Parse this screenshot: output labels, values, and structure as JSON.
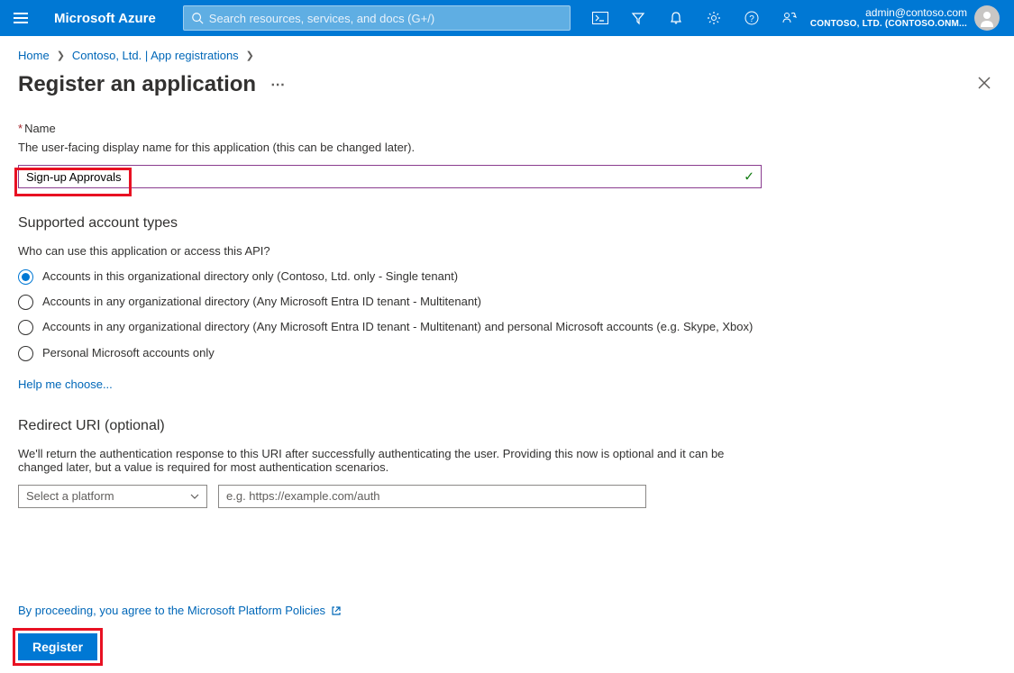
{
  "header": {
    "brand": "Microsoft Azure",
    "search_placeholder": "Search resources, services, and docs (G+/)",
    "user_email": "admin@contoso.com",
    "user_tenant": "CONTOSO, LTD. (CONTOSO.ONM..."
  },
  "breadcrumb": {
    "items": [
      "Home",
      "Contoso, Ltd. | App registrations"
    ]
  },
  "page": {
    "title": "Register an application"
  },
  "form": {
    "name_label": "Name",
    "name_desc": "The user-facing display name for this application (this can be changed later).",
    "name_value": "Sign-up Approvals",
    "account_types_title": "Supported account types",
    "account_types_question": "Who can use this application or access this API?",
    "account_options": [
      {
        "label": "Accounts in this organizational directory only (Contoso, Ltd. only - Single tenant)",
        "selected": true
      },
      {
        "label": "Accounts in any organizational directory (Any Microsoft Entra ID tenant - Multitenant)",
        "selected": false
      },
      {
        "label": "Accounts in any organizational directory (Any Microsoft Entra ID tenant - Multitenant) and personal Microsoft accounts (e.g. Skype, Xbox)",
        "selected": false
      },
      {
        "label": "Personal Microsoft accounts only",
        "selected": false
      }
    ],
    "help_choose": "Help me choose...",
    "redirect_title": "Redirect URI (optional)",
    "redirect_desc": "We'll return the authentication response to this URI after successfully authenticating the user. Providing this now is optional and it can be changed later, but a value is required for most authentication scenarios.",
    "platform_placeholder": "Select a platform",
    "uri_placeholder": "e.g. https://example.com/auth"
  },
  "footer": {
    "policy_text": "By proceeding, you agree to the Microsoft Platform Policies",
    "register_label": "Register"
  }
}
